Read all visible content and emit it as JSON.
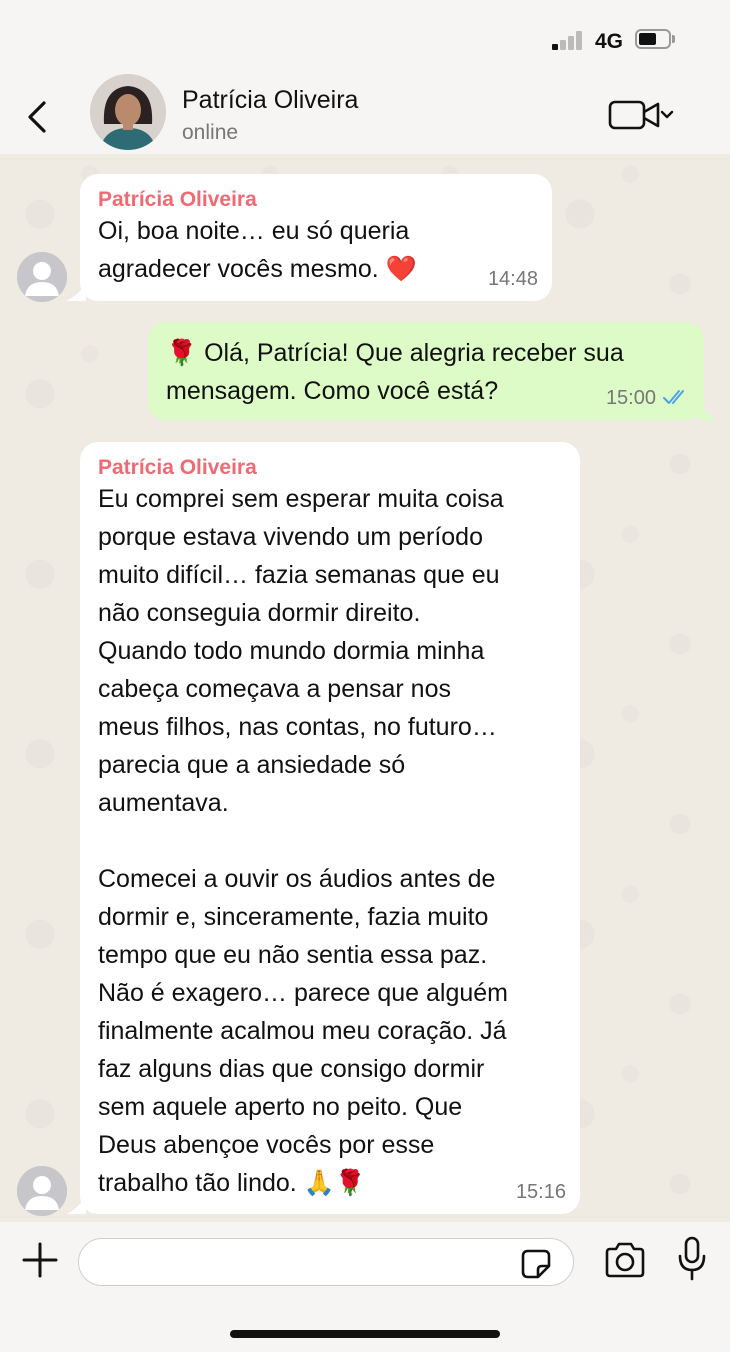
{
  "status_bar": {
    "network": "4G"
  },
  "header": {
    "contact_name": "Patrícia Oliveira",
    "contact_status": "online",
    "icons": {
      "back": "chevron-left-icon",
      "video": "video-call-icon",
      "dropdown": "chevron-down-icon"
    }
  },
  "messages": [
    {
      "direction": "incoming",
      "sender": "Patrícia Oliveira",
      "text": "Oi, boa noite… eu só queria\nagradecer vocês mesmo. ❤️",
      "time": "14:48"
    },
    {
      "direction": "outgoing",
      "text": "🌹 Olá, Patrícia! Que alegria receber sua\nmensagem. Como você está?",
      "time": "15:00",
      "read": true
    },
    {
      "direction": "incoming",
      "sender": "Patrícia Oliveira",
      "text": "Eu comprei sem esperar muita coisa\nporque estava vivendo um período\nmuito difícil… fazia semanas que eu\nnão conseguia dormir direito.\nQuando todo mundo dormia minha\ncabeça começava a pensar nos\nmeus filhos, nas contas, no futuro…\nparecia que a ansiedade só\naumentava.\n\nComecei a ouvir os áudios antes de\ndormir e, sinceramente, fazia muito\ntempo que eu não sentia essa paz.\nNão é exagero… parece que alguém\nfinalmente acalmou meu coração. Já\nfaz alguns dias que consigo dormir\nsem aquele aperto no peito. Que\nDeus abençoe vocês por esse\ntrabalho tão lindo. 🙏🌹",
      "time": "15:16"
    }
  ],
  "composer": {
    "input_value": "",
    "icons": {
      "add": "plus-icon",
      "sticker": "sticker-icon",
      "camera": "camera-icon",
      "mic": "microphone-icon"
    }
  },
  "colors": {
    "incoming_bubble": "#ffffff",
    "outgoing_bubble": "#dcfbc6",
    "sender_name": "#ef6a72",
    "read_ticks": "#4aa3e8",
    "chat_background": "#efeae2"
  }
}
